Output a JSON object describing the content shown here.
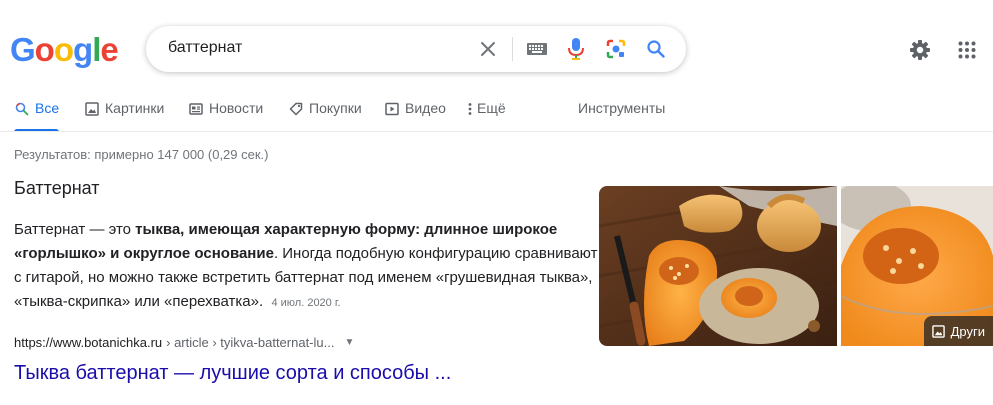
{
  "logo": {
    "letters": [
      "G",
      "o",
      "o",
      "g",
      "l",
      "e"
    ],
    "colors": [
      "#4285f4",
      "#ea4335",
      "#fbbc05",
      "#4285f4",
      "#34a853",
      "#ea4335"
    ]
  },
  "search": {
    "query": "баттернат"
  },
  "icons": {
    "clear": "close-icon",
    "keyboard": "keyboard-icon",
    "mic": "mic-icon",
    "lens": "camera-lens-icon",
    "search": "search-icon",
    "settings": "gear-icon",
    "apps": "apps-grid-icon"
  },
  "tabs": [
    {
      "label": "Все",
      "icon": "search-icon",
      "active": true
    },
    {
      "label": "Картинки",
      "icon": "image-icon"
    },
    {
      "label": "Новости",
      "icon": "news-icon"
    },
    {
      "label": "Покупки",
      "icon": "tag-icon"
    },
    {
      "label": "Видео",
      "icon": "video-icon"
    },
    {
      "label": "Ещё",
      "icon": "more-vert-icon"
    }
  ],
  "tools_label": "Инструменты",
  "stats": "Результатов: примерно 147 000 (0,29 сек.)",
  "snippet": {
    "title": "Баттернат",
    "text_1": "Баттернат — это ",
    "text_bold": "тыква, имеющая характерную форму: длинное широкое «горлышко» и округлое основание",
    "text_2": ". Иногда подобную конфигурацию сравнивают с гитарой, но можно также встретить баттернат под именем «грушевидная тыква», «тыква-скрипка» или «перехватка».",
    "date": "4 июл. 2020 г."
  },
  "result": {
    "domain": "https://www.botanichka.ru",
    "path": "› article › tyikva-batternat-lu...",
    "title": "Тыква баттернат — лучшие сорта и способы ..."
  },
  "images": {
    "more_label": "Други"
  },
  "colors": {
    "accent": "#1a73e8",
    "link": "#1a0dab",
    "muted": "#70757a"
  }
}
